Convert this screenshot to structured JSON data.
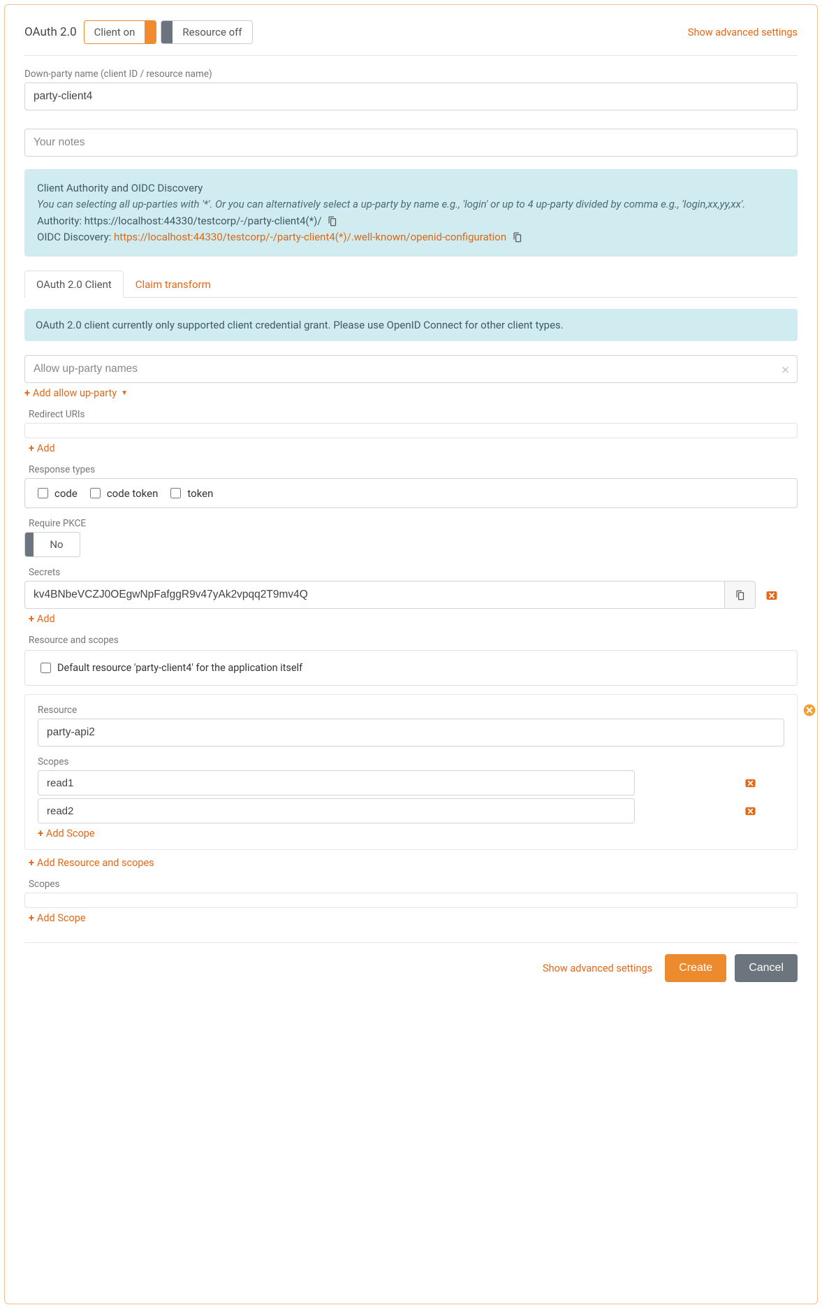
{
  "header": {
    "title": "OAuth 2.0",
    "toggles": {
      "client": "Client on",
      "resource": "Resource off"
    },
    "advanced_link": "Show advanced settings"
  },
  "down_party": {
    "label": "Down-party name (client ID / resource name)",
    "value": "party-client4"
  },
  "notes": {
    "placeholder": "Your notes"
  },
  "authority_box": {
    "heading": "Client Authority and OIDC Discovery",
    "hint": "You can selecting all up-parties with '*'. Or you can alternatively select a up-party by name e.g., 'login' or up to 4 up-party divided by comma e.g., 'login,xx,yy,xx'.",
    "authority_label": "Authority: ",
    "authority_value": "https://localhost:44330/testcorp/-/party-client4(*)/",
    "discovery_label": "OIDC Discovery: ",
    "discovery_value": "https://localhost:44330/testcorp/-/party-client4(*)/.well-known/openid-configuration"
  },
  "tabs": {
    "client": "OAuth 2.0 Client",
    "claims": "Claim transform"
  },
  "client_notice": "OAuth 2.0 client currently only supported client credential grant. Please use OpenID Connect for other client types.",
  "allow_up": {
    "placeholder": "Allow up-party names",
    "add_label": "Add allow up-party"
  },
  "redirect": {
    "label": "Redirect URIs",
    "add": "Add"
  },
  "response_types": {
    "label": "Response types",
    "opts": [
      "code",
      "code token",
      "token"
    ]
  },
  "pkce": {
    "label": "Require PKCE",
    "value": "No"
  },
  "secrets": {
    "label": "Secrets",
    "value": "kv4BNbeVCZJ0OEgwNpFafggR9v47yAk2vpqq2T9mv4Q",
    "add": "Add"
  },
  "resource_scopes": {
    "label": "Resource and scopes",
    "default_label": "Default resource 'party-client4' for the application itself",
    "resource_label": "Resource",
    "resource_value": "party-api2",
    "scopes_label": "Scopes",
    "scopes": [
      "read1",
      "read2"
    ],
    "add_scope": "Add Scope",
    "add_resource": "Add Resource and scopes"
  },
  "outer_scopes": {
    "label": "Scopes",
    "add": "Add Scope"
  },
  "footer": {
    "advanced": "Show advanced settings",
    "create": "Create",
    "cancel": "Cancel"
  }
}
